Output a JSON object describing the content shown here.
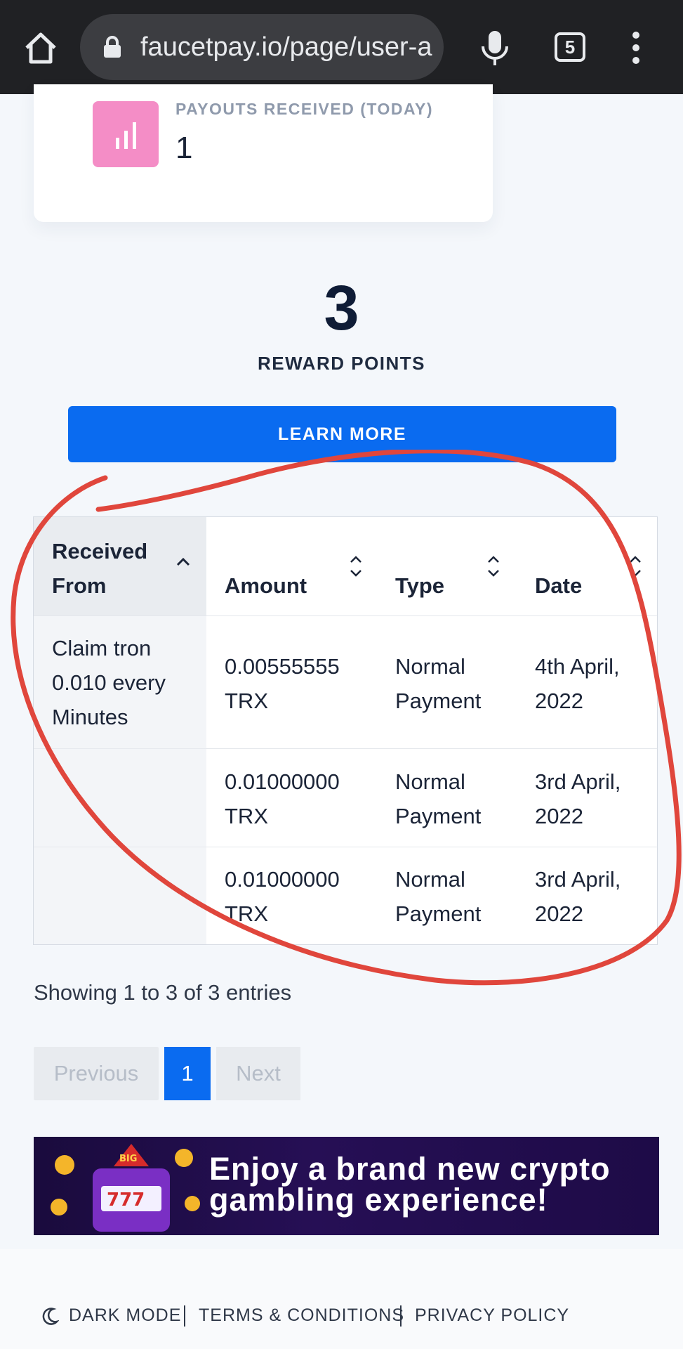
{
  "browser": {
    "url": "faucetpay.io/page/user-a",
    "tab_count": "5"
  },
  "stats": {
    "payouts_label": "PAYOUTS RECEIVED (TODAY)",
    "payouts_value": "1"
  },
  "reward": {
    "points": "3",
    "label": "REWARD POINTS",
    "button": "LEARN MORE"
  },
  "table": {
    "headers": {
      "received_from_line1": "Received",
      "received_from_line2": "From",
      "amount": "Amount",
      "type": "Type",
      "date": "Date"
    },
    "rows": [
      {
        "received_from": [
          "Claim tron",
          "0.010 every",
          "Minutes"
        ],
        "amount": [
          "0.00555555",
          "TRX"
        ],
        "type": [
          "Normal",
          "Payment"
        ],
        "date": [
          "4th April,",
          "2022"
        ]
      },
      {
        "received_from": [],
        "amount": [
          "0.01000000",
          "TRX"
        ],
        "type": [
          "Normal",
          "Payment"
        ],
        "date": [
          "3rd April,",
          "2022"
        ]
      },
      {
        "received_from": [],
        "amount": [
          "0.01000000",
          "TRX"
        ],
        "type": [
          "Normal",
          "Payment"
        ],
        "date": [
          "3rd April,",
          "2022"
        ]
      }
    ]
  },
  "entries_info": "Showing 1 to 3 of 3 entries",
  "pagination": {
    "previous": "Previous",
    "current": "1",
    "next": "Next"
  },
  "ad": {
    "line1": "Enjoy a brand new crypto",
    "line2": "gambling experience!"
  },
  "footer": {
    "dark_mode": "DARK MODE",
    "terms": "TERMS & CONDITIONS",
    "privacy": "PRIVACY POLICY"
  },
  "colors": {
    "primary": "#0a6bf0",
    "stat_icon_bg": "#f48dc6",
    "annotation": "#e0463c"
  }
}
